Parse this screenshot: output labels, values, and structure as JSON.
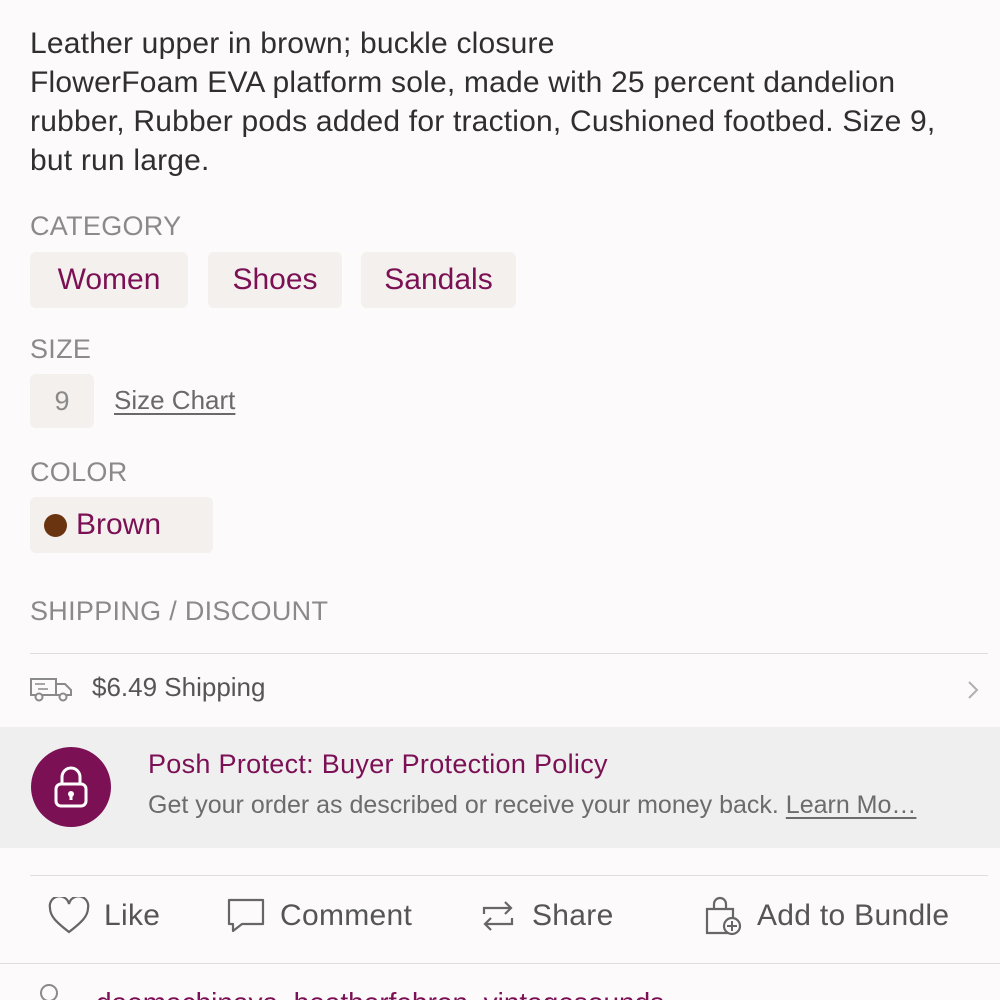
{
  "description": "Leather upper in brown; buckle closure\nFlowerFoam EVA platform sole, made with 25 percent dandelion rubber, Rubber pods added for traction, Cushioned footbed. Size 9, but run large.",
  "category": {
    "label": "CATEGORY",
    "chips": [
      "Women",
      "Shoes",
      "Sandals"
    ]
  },
  "size": {
    "label": "SIZE",
    "value": "9",
    "chart_link": "Size Chart"
  },
  "color": {
    "label": "COLOR",
    "name": "Brown",
    "swatch": "#6b3410"
  },
  "shipping": {
    "label": "SHIPPING / DISCOUNT",
    "text": "$6.49 Shipping"
  },
  "protect": {
    "title": "Posh Protect: Buyer Protection Policy",
    "subtitle": "Get your order as described or receive your money back. ",
    "learn_more": "Learn Mo…"
  },
  "actions": {
    "like": "Like",
    "comment": "Comment",
    "share": "Share",
    "bundle": "Add to Bundle"
  },
  "likes_peek": "daemachinaya, heatherfebron, vintagesounds",
  "colors": {
    "brand": "#7b1055",
    "chip_bg": "#f3f0ed",
    "muted": "#8a8a8a"
  }
}
